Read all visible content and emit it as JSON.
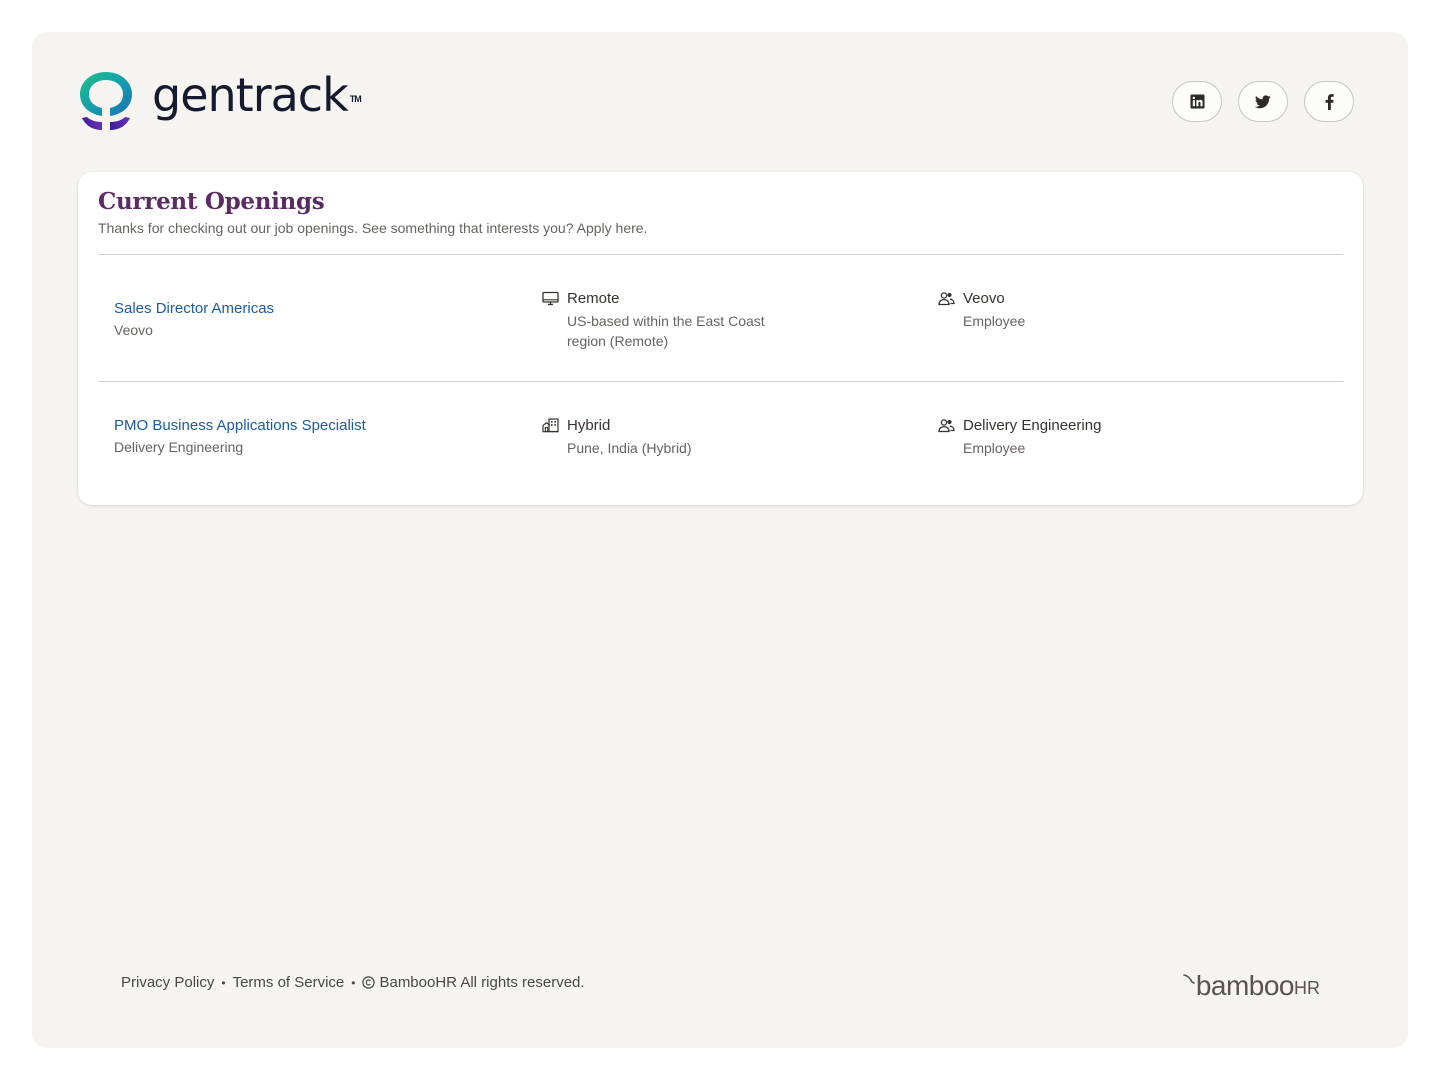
{
  "header": {
    "logo_text": "gentrack",
    "logo_tm": "TM",
    "social": [
      {
        "name": "linkedin",
        "icon": "linkedin-icon"
      },
      {
        "name": "twitter",
        "icon": "twitter-icon"
      },
      {
        "name": "facebook",
        "icon": "facebook-icon"
      }
    ]
  },
  "openings": {
    "title": "Current Openings",
    "subtitle": "Thanks for checking out our job openings. See something that interests you? Apply here.",
    "jobs": [
      {
        "title": "Sales Director Americas",
        "department": "Veovo",
        "location_type": "Remote",
        "location_type_icon": "monitor-icon",
        "location": "US-based within the East Coast region (Remote)",
        "team": "Veovo",
        "team_icon": "people-icon",
        "employment": "Employee"
      },
      {
        "title": "PMO Business Applications Specialist",
        "department": "Delivery Engineering",
        "location_type": "Hybrid",
        "location_type_icon": "hybrid-building-icon",
        "location": "Pune, India (Hybrid)",
        "team": "Delivery Engineering",
        "team_icon": "people-icon",
        "employment": "Employee"
      }
    ]
  },
  "footer": {
    "privacy": "Privacy Policy",
    "terms": "Terms of Service",
    "copyright": "BambooHR All rights reserved.",
    "brand_main": "bamboo",
    "brand_hr": "HR"
  },
  "colors": {
    "page_bg": "#f5f4f1",
    "title_purple": "#5b2b63",
    "link_blue": "#1a5ba6"
  }
}
